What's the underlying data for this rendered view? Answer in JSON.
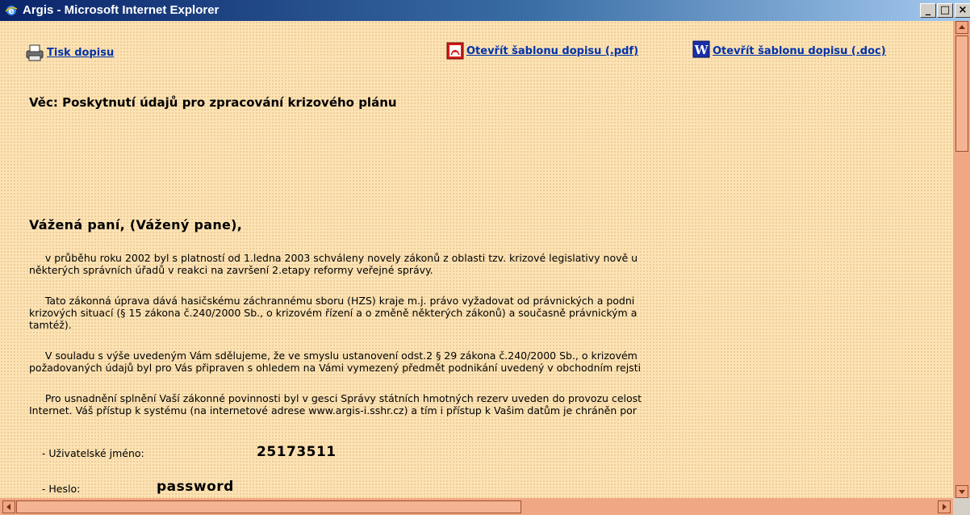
{
  "window": {
    "title": "Argis - Microsoft Internet Explorer",
    "minimize_label": "_",
    "maximize_label": "□",
    "close_label": "×"
  },
  "toolbar": {
    "print_label": "Tisk dopisu",
    "open_pdf_label": "Otevřít šablonu dopisu (.pdf)",
    "open_doc_label": "Otevřít šablonu dopisu (.doc)",
    "print_icon": "printer-icon",
    "pdf_icon": "pdf-icon",
    "doc_icon": "word-icon"
  },
  "letter": {
    "subject": "Věc: Poskytnutí údajů pro zpracování krizového plánu",
    "greeting": "Vážená paní, (Vážený pane),",
    "paragraphs": {
      "p1": "     v průběhu roku 2002 byl s platností od 1.ledna 2003 schváleny novely zákonů z oblasti tzv. krizové legislativy nově u\nněkterých správních úřadů v reakci na završení 2.etapy reformy veřejné správy.",
      "p2": "     Tato zákonná úprava dává hasičskému záchrannému sboru (HZS) kraje m.j. právo vyžadovat od právnických a podni\nkrizových situací (§ 15 zákona č.240/2000 Sb., o krizovém řízení a o změně některých zákonů) a současně právnickým a\ntamtéž).",
      "p3": "     V souladu s výše uvedeným Vám sdělujeme, že ve smyslu ustanovení odst.2 § 29 zákona č.240/2000 Sb., o krizovém\npožadovaných údajů byl pro Vás připraven s ohledem na Vámi vymezený předmět podnikání uvedený v obchodním rejsti",
      "p4": "     Pro usnadnění splnění Vaší zákonné povinnosti byl v gesci Správy státních hmotných rezerv uveden do provozu celost\nInternet. Váš přístup k systému (na internetové adrese www.argis-i.sshr.cz) a tím i přístup k Vašim datům je chráněn por"
    },
    "credentials": {
      "username_label": "    - Uživatelské jméno:",
      "username_value": "25173511",
      "password_label": "    - Heslo:",
      "password_value": "password"
    }
  },
  "colors": {
    "page_background": "#fce3b5",
    "link": "#0033aa",
    "scrollbar": "#f0a884",
    "titlebar_start": "#0a246a",
    "titlebar_end": "#a6caf0"
  }
}
